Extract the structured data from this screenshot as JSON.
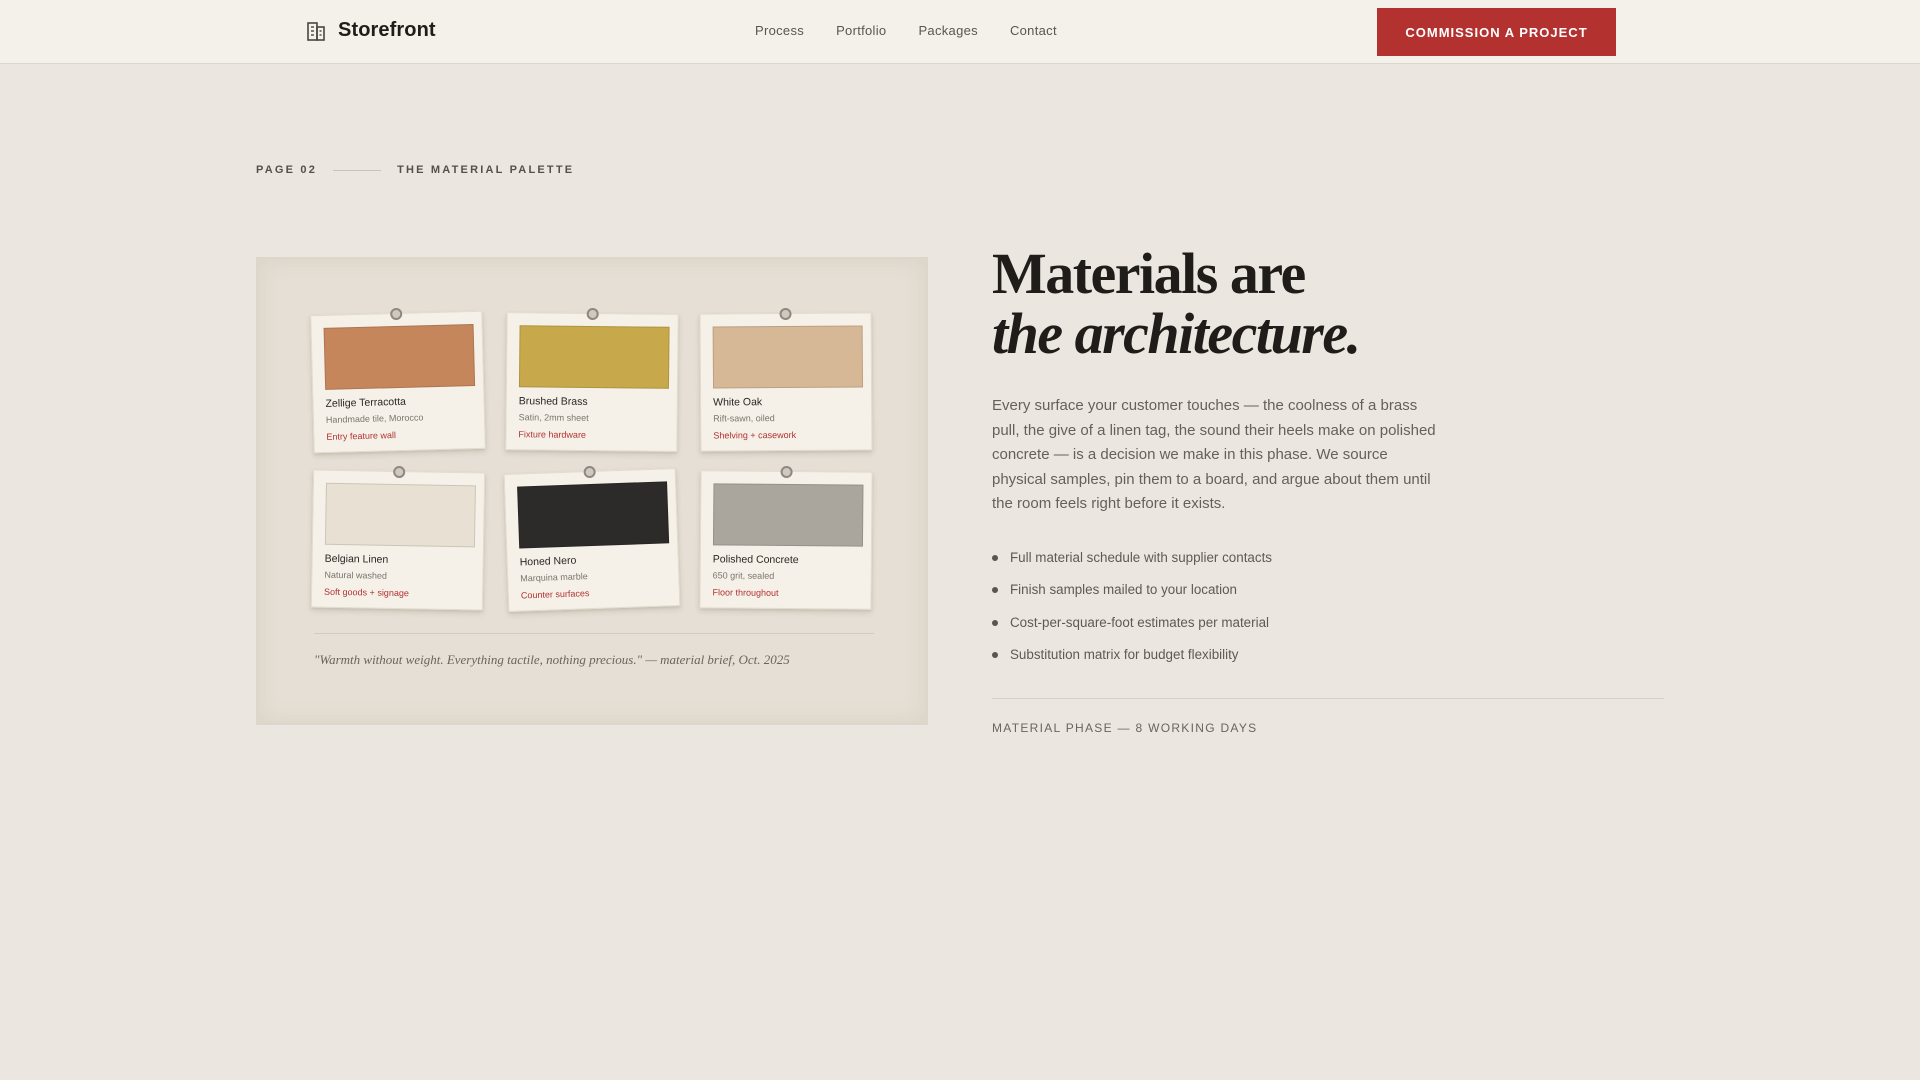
{
  "header": {
    "brand": "Storefront",
    "brand_icon": "building-icon",
    "nav": [
      "Process",
      "Portfolio",
      "Packages",
      "Contact"
    ],
    "cta_label": "COMMISSION A PROJECT",
    "cta_color": "#b3322f"
  },
  "eyebrow": {
    "page": "PAGE 02",
    "section": "THE MATERIAL PALETTE"
  },
  "board": {
    "cards": [
      {
        "name": "Zellige Terracotta",
        "spec": "Handmade tile, Morocco",
        "use": "Entry feature wall",
        "color": "#c5865c"
      },
      {
        "name": "Brushed Brass",
        "spec": "Satin, 2mm sheet",
        "use": "Fixture hardware",
        "color": "#c7a84a"
      },
      {
        "name": "White Oak",
        "spec": "Rift-sawn, oiled",
        "use": "Shelving + casework",
        "color": "#d6b796"
      },
      {
        "name": "Belgian Linen",
        "spec": "Natural washed",
        "use": "Soft goods + signage",
        "color": "#e8e0d2"
      },
      {
        "name": "Honed Nero",
        "spec": "Marquina marble",
        "use": "Counter surfaces",
        "color": "#2d2b29"
      },
      {
        "name": "Polished Concrete",
        "spec": "650 grit, sealed",
        "use": "Floor throughout",
        "color": "#aaa59d"
      }
    ],
    "quote": "\"Warmth without weight. Everything tactile, nothing precious.\" — material brief, Oct. 2025"
  },
  "content": {
    "headline_line1": "Materials are",
    "headline_line2": "the architecture.",
    "body": "Every surface your customer touches — the coolness of a brass pull, the give of a linen tag, the sound their heels make on polished concrete — is a decision we make in this phase. We source physical samples, pin them to a board, and argue about them until the room feels right before it exists.",
    "features": [
      "Full material schedule with supplier contacts",
      "Finish samples mailed to your location",
      "Cost-per-square-foot estimates per material",
      "Substitution matrix for budget flexibility"
    ],
    "phase": "MATERIAL PHASE — 8 WORKING DAYS"
  }
}
